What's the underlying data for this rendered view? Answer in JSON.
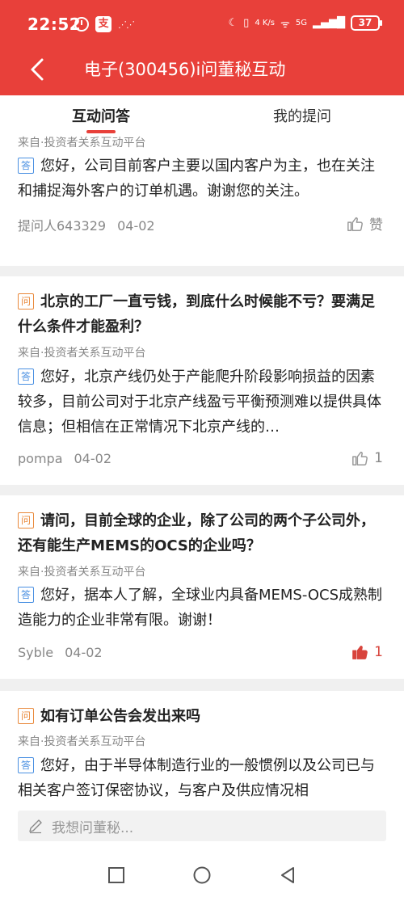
{
  "status_bar": {
    "time": "22:52",
    "alipay_label": "支",
    "net_label": "4G",
    "speed_label": "4 K/s",
    "signal_label": "5G",
    "battery": "37"
  },
  "nav": {
    "title": "电子(300456)i问董秘互动"
  },
  "tabs": [
    {
      "label": "互动问答",
      "active": true
    },
    {
      "label": "我的提问",
      "active": false
    }
  ],
  "badges": {
    "question": "问",
    "answer": "答"
  },
  "feed": [
    {
      "question": "",
      "source": "来自·投资者关系互动平台",
      "answer": "您好，公司目前客户主要以国内客户为主，也在关注和捕捉海外客户的订单机遇。谢谢您的关注。",
      "user": "提问人643329",
      "date": "04-02",
      "like_text": "赞",
      "liked": false
    },
    {
      "question": "北京的工厂一直亏钱，到底什么时候能不亏？要满足什么条件才能盈利？",
      "source": "来自·投资者关系互动平台",
      "answer": "您好，北京产线仍处于产能爬升阶段影响损益的因素较多，目前公司对于北京产线盈亏平衡预测难以提供具体信息；但相信在正常情况下北京产线的…",
      "user": "pompa",
      "date": "04-02",
      "like_text": "1",
      "liked": false
    },
    {
      "question": "请问，目前全球的企业，除了公司的两个子公司外，还有能生产MEMS的OCS的企业吗？",
      "source": "来自·投资者关系互动平台",
      "answer": "您好，据本人了解，全球业内具备MEMS-OCS成熟制造能力的企业非常有限。谢谢！",
      "user": "Syble",
      "date": "04-02",
      "like_text": "1",
      "liked": true
    },
    {
      "question": "如有订单公告会发出来吗",
      "source": "来自·投资者关系互动平台",
      "answer": "您好，由于半导体制造行业的一般惯例以及公司已与相关客户签订保密协议，与客户及供应情况相",
      "user": "",
      "date": "",
      "like_text": "",
      "liked": false
    }
  ],
  "ask_input": {
    "placeholder": "我想问董秘..."
  },
  "colors": {
    "header": "#e8403a",
    "question_badge": "#e9893b",
    "answer_badge": "#4a90e2",
    "liked": "#d8443c"
  }
}
